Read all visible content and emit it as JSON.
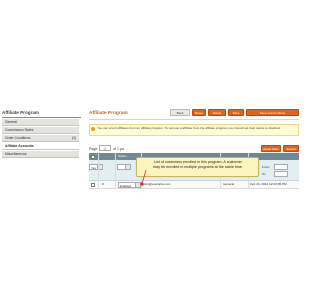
{
  "sidebar": {
    "title": "Affiliate Program",
    "items": [
      {
        "label": "General",
        "count": ""
      },
      {
        "label": "Commission Rates",
        "count": ""
      },
      {
        "label": "Order Conditions",
        "count": "(1)"
      },
      {
        "label": "Affiliate Accounts",
        "count": "",
        "active": true
      },
      {
        "label": "Miscellaneous",
        "count": ""
      }
    ]
  },
  "header": {
    "title": "Affiliate Program",
    "buttons": {
      "back": "Back",
      "reset": "Reset",
      "delete": "Delete",
      "save": "Save",
      "save_continue": "Save and Continue"
    }
  },
  "notice": {
    "text": "You can enroll affiliates from an affiliate program. To remove a affiliate from the affiliate program you should set their status to disabled."
  },
  "grid": {
    "page_label": "Page",
    "page_value": "1",
    "page_of": "of 1 pa",
    "buttons": {
      "reset_filter": "Reset Filter",
      "search": "Search"
    },
    "headers": {
      "status": "Status"
    },
    "filter": {
      "select_value": "Yes",
      "from_label": "From:",
      "to_label": "To:"
    },
    "row": {
      "id": "8",
      "status": "Enabled",
      "email": "john@example.com",
      "group": "General",
      "date": "Feb 24, 2014 12:23:05 PM"
    }
  },
  "callout": {
    "line1": "List of customers enrolled in this program. A customer",
    "line2": "may be enrolled in multiple programs at the same time."
  },
  "colors": {
    "accent": "#e0621d",
    "title": "#e25a11",
    "grid_header": "#6f8995"
  }
}
